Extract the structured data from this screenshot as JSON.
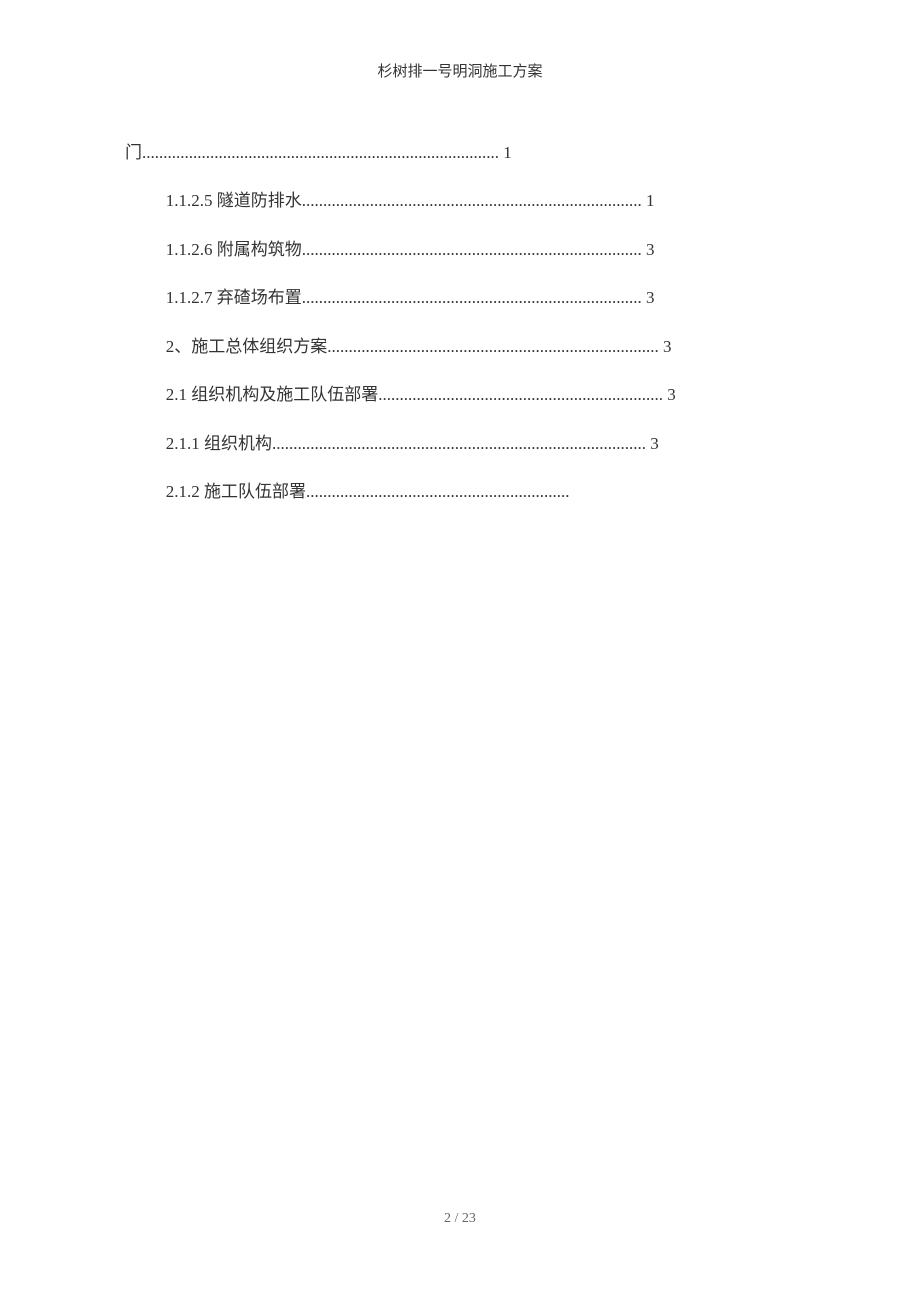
{
  "header": {
    "title": "杉树排一号明洞施工方案"
  },
  "toc": {
    "entries": [
      {
        "prefix": "",
        "text": "门",
        "dots": ".................................................................................... ",
        "page": "1"
      },
      {
        "prefix": "1.1.2.5 ",
        "text": "隧道防排水",
        "dots": "................................................................................ ",
        "page": "1"
      },
      {
        "prefix": "1.1.2.6 ",
        "text": "附属构筑物",
        "dots": "................................................................................ ",
        "page": "3"
      },
      {
        "prefix": "1.1.2.7 ",
        "text": "弃碴场布置",
        "dots": "................................................................................ ",
        "page": "3"
      },
      {
        "prefix": "2、",
        "text": "施工总体组织方案",
        "dots": ".............................................................................. ",
        "page": "3"
      },
      {
        "prefix": "2.1 ",
        "text": "组织机构及施工队伍部署",
        "dots": "...................................................................  ",
        "page": "3"
      },
      {
        "prefix": "2.1.1 ",
        "text": "组织机构",
        "dots": "........................................................................................ ",
        "page": "3"
      },
      {
        "prefix": "2.1.2 ",
        "text": "施工队伍部署",
        "dots": "..............................................................",
        "page": ""
      }
    ]
  },
  "footer": {
    "page_number": "2 / 23"
  }
}
